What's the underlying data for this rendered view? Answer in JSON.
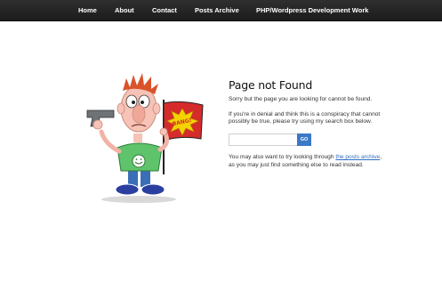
{
  "nav": {
    "items": [
      {
        "label": "Home"
      },
      {
        "label": "About"
      },
      {
        "label": "Contact"
      },
      {
        "label": "Posts Archive"
      },
      {
        "label": "PHP/Wordpress Development Work"
      }
    ]
  },
  "illustration": {
    "flag_text": "BANG!",
    "face_icon": "smiley-face-icon"
  },
  "content": {
    "title": "Page not Found",
    "para1": "Sorry but the page you are looking for cannot be found.",
    "para2": "If you're in denial and think this is a conspiracy that cannot possibly be true, please try using my search box below.",
    "search": {
      "placeholder": "",
      "value": "",
      "button_label": "GO"
    },
    "para3_before": "You may also want to try looking through ",
    "para3_link": "the posts archive",
    "para3_after": ", as you may just find something else to read instead."
  },
  "colors": {
    "nav_bg": "#222222",
    "link": "#2f6fc0",
    "button": "#3b79c7",
    "flag": "#d62b2b",
    "burst": "#f5d300",
    "shirt": "#5ec36a",
    "jeans": "#3a6fb8"
  }
}
